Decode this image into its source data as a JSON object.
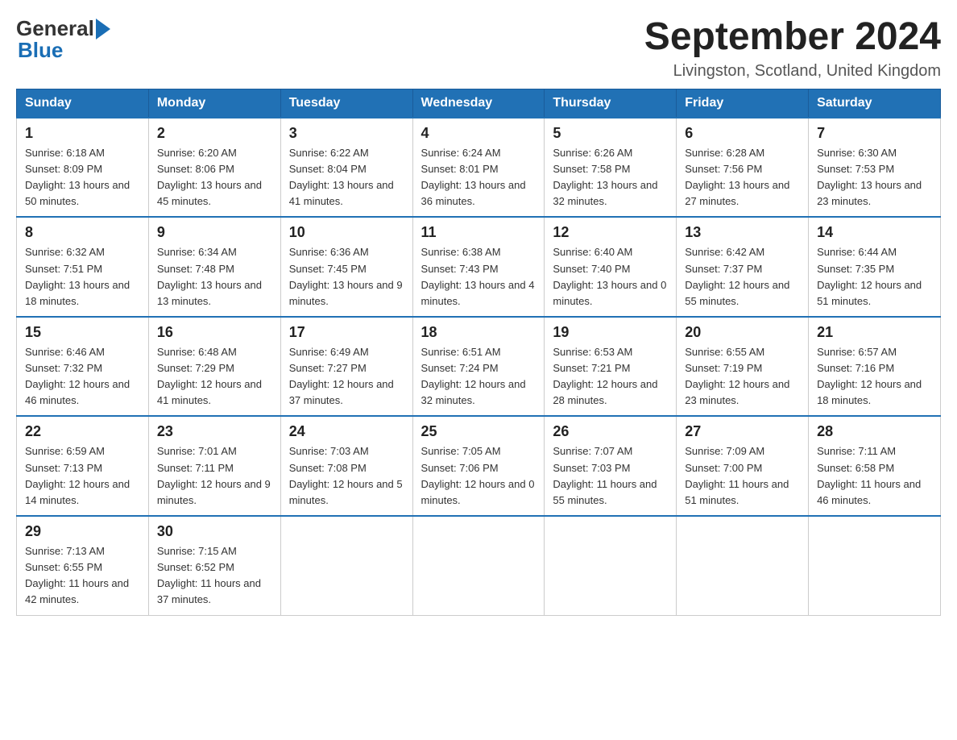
{
  "header": {
    "month_title": "September 2024",
    "location": "Livingston, Scotland, United Kingdom",
    "logo_general": "General",
    "logo_blue": "Blue"
  },
  "weekdays": [
    "Sunday",
    "Monday",
    "Tuesday",
    "Wednesday",
    "Thursday",
    "Friday",
    "Saturday"
  ],
  "weeks": [
    [
      {
        "day": "1",
        "sunrise": "Sunrise: 6:18 AM",
        "sunset": "Sunset: 8:09 PM",
        "daylight": "Daylight: 13 hours and 50 minutes."
      },
      {
        "day": "2",
        "sunrise": "Sunrise: 6:20 AM",
        "sunset": "Sunset: 8:06 PM",
        "daylight": "Daylight: 13 hours and 45 minutes."
      },
      {
        "day": "3",
        "sunrise": "Sunrise: 6:22 AM",
        "sunset": "Sunset: 8:04 PM",
        "daylight": "Daylight: 13 hours and 41 minutes."
      },
      {
        "day": "4",
        "sunrise": "Sunrise: 6:24 AM",
        "sunset": "Sunset: 8:01 PM",
        "daylight": "Daylight: 13 hours and 36 minutes."
      },
      {
        "day": "5",
        "sunrise": "Sunrise: 6:26 AM",
        "sunset": "Sunset: 7:58 PM",
        "daylight": "Daylight: 13 hours and 32 minutes."
      },
      {
        "day": "6",
        "sunrise": "Sunrise: 6:28 AM",
        "sunset": "Sunset: 7:56 PM",
        "daylight": "Daylight: 13 hours and 27 minutes."
      },
      {
        "day": "7",
        "sunrise": "Sunrise: 6:30 AM",
        "sunset": "Sunset: 7:53 PM",
        "daylight": "Daylight: 13 hours and 23 minutes."
      }
    ],
    [
      {
        "day": "8",
        "sunrise": "Sunrise: 6:32 AM",
        "sunset": "Sunset: 7:51 PM",
        "daylight": "Daylight: 13 hours and 18 minutes."
      },
      {
        "day": "9",
        "sunrise": "Sunrise: 6:34 AM",
        "sunset": "Sunset: 7:48 PM",
        "daylight": "Daylight: 13 hours and 13 minutes."
      },
      {
        "day": "10",
        "sunrise": "Sunrise: 6:36 AM",
        "sunset": "Sunset: 7:45 PM",
        "daylight": "Daylight: 13 hours and 9 minutes."
      },
      {
        "day": "11",
        "sunrise": "Sunrise: 6:38 AM",
        "sunset": "Sunset: 7:43 PM",
        "daylight": "Daylight: 13 hours and 4 minutes."
      },
      {
        "day": "12",
        "sunrise": "Sunrise: 6:40 AM",
        "sunset": "Sunset: 7:40 PM",
        "daylight": "Daylight: 13 hours and 0 minutes."
      },
      {
        "day": "13",
        "sunrise": "Sunrise: 6:42 AM",
        "sunset": "Sunset: 7:37 PM",
        "daylight": "Daylight: 12 hours and 55 minutes."
      },
      {
        "day": "14",
        "sunrise": "Sunrise: 6:44 AM",
        "sunset": "Sunset: 7:35 PM",
        "daylight": "Daylight: 12 hours and 51 minutes."
      }
    ],
    [
      {
        "day": "15",
        "sunrise": "Sunrise: 6:46 AM",
        "sunset": "Sunset: 7:32 PM",
        "daylight": "Daylight: 12 hours and 46 minutes."
      },
      {
        "day": "16",
        "sunrise": "Sunrise: 6:48 AM",
        "sunset": "Sunset: 7:29 PM",
        "daylight": "Daylight: 12 hours and 41 minutes."
      },
      {
        "day": "17",
        "sunrise": "Sunrise: 6:49 AM",
        "sunset": "Sunset: 7:27 PM",
        "daylight": "Daylight: 12 hours and 37 minutes."
      },
      {
        "day": "18",
        "sunrise": "Sunrise: 6:51 AM",
        "sunset": "Sunset: 7:24 PM",
        "daylight": "Daylight: 12 hours and 32 minutes."
      },
      {
        "day": "19",
        "sunrise": "Sunrise: 6:53 AM",
        "sunset": "Sunset: 7:21 PM",
        "daylight": "Daylight: 12 hours and 28 minutes."
      },
      {
        "day": "20",
        "sunrise": "Sunrise: 6:55 AM",
        "sunset": "Sunset: 7:19 PM",
        "daylight": "Daylight: 12 hours and 23 minutes."
      },
      {
        "day": "21",
        "sunrise": "Sunrise: 6:57 AM",
        "sunset": "Sunset: 7:16 PM",
        "daylight": "Daylight: 12 hours and 18 minutes."
      }
    ],
    [
      {
        "day": "22",
        "sunrise": "Sunrise: 6:59 AM",
        "sunset": "Sunset: 7:13 PM",
        "daylight": "Daylight: 12 hours and 14 minutes."
      },
      {
        "day": "23",
        "sunrise": "Sunrise: 7:01 AM",
        "sunset": "Sunset: 7:11 PM",
        "daylight": "Daylight: 12 hours and 9 minutes."
      },
      {
        "day": "24",
        "sunrise": "Sunrise: 7:03 AM",
        "sunset": "Sunset: 7:08 PM",
        "daylight": "Daylight: 12 hours and 5 minutes."
      },
      {
        "day": "25",
        "sunrise": "Sunrise: 7:05 AM",
        "sunset": "Sunset: 7:06 PM",
        "daylight": "Daylight: 12 hours and 0 minutes."
      },
      {
        "day": "26",
        "sunrise": "Sunrise: 7:07 AM",
        "sunset": "Sunset: 7:03 PM",
        "daylight": "Daylight: 11 hours and 55 minutes."
      },
      {
        "day": "27",
        "sunrise": "Sunrise: 7:09 AM",
        "sunset": "Sunset: 7:00 PM",
        "daylight": "Daylight: 11 hours and 51 minutes."
      },
      {
        "day": "28",
        "sunrise": "Sunrise: 7:11 AM",
        "sunset": "Sunset: 6:58 PM",
        "daylight": "Daylight: 11 hours and 46 minutes."
      }
    ],
    [
      {
        "day": "29",
        "sunrise": "Sunrise: 7:13 AM",
        "sunset": "Sunset: 6:55 PM",
        "daylight": "Daylight: 11 hours and 42 minutes."
      },
      {
        "day": "30",
        "sunrise": "Sunrise: 7:15 AM",
        "sunset": "Sunset: 6:52 PM",
        "daylight": "Daylight: 11 hours and 37 minutes."
      },
      null,
      null,
      null,
      null,
      null
    ]
  ]
}
